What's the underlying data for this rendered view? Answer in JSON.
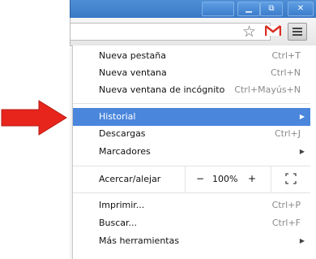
{
  "window": {
    "minimize_glyph": "▁",
    "maximize_glyph": "⧉",
    "close_glyph": "✕"
  },
  "toolbar": {
    "bookmark_icon": "star-icon",
    "extension_icon": "gmail-icon",
    "menu_icon": "hamburger-icon"
  },
  "menu": {
    "group1": [
      {
        "label": "Nueva pestaña",
        "shortcut": "Ctrl+T"
      },
      {
        "label": "Nueva ventana",
        "shortcut": "Ctrl+N"
      },
      {
        "label": "Nueva ventana de incógnito",
        "shortcut": "Ctrl+Mayús+N"
      }
    ],
    "group2": [
      {
        "label": "Historial",
        "shortcut": "",
        "submenu": true,
        "highlighted": true
      },
      {
        "label": "Descargas",
        "shortcut": "Ctrl+J"
      },
      {
        "label": "Marcadores",
        "shortcut": "",
        "submenu": true
      }
    ],
    "zoom": {
      "label": "Acercar/alejar",
      "minus": "−",
      "value": "100%",
      "plus": "+"
    },
    "group3": [
      {
        "label": "Imprimir...",
        "shortcut": "Ctrl+P"
      },
      {
        "label": "Buscar...",
        "shortcut": "Ctrl+F"
      },
      {
        "label": "Más herramientas",
        "shortcut": "",
        "submenu": true
      }
    ],
    "submenu_arrow": "▶"
  },
  "colors": {
    "highlight": "#4a86dc",
    "title_bar": "#3b78c6",
    "arrow": "#e8251d"
  }
}
